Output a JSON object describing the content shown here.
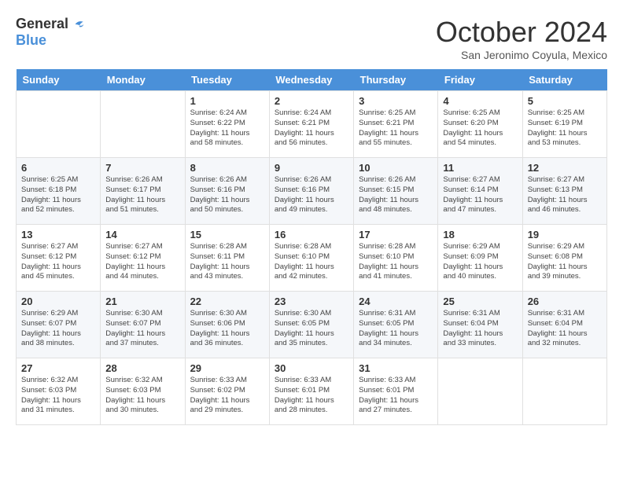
{
  "logo": {
    "general": "General",
    "blue": "Blue"
  },
  "header": {
    "title": "October 2024",
    "subtitle": "San Jeronimo Coyula, Mexico"
  },
  "weekdays": [
    "Sunday",
    "Monday",
    "Tuesday",
    "Wednesday",
    "Thursday",
    "Friday",
    "Saturday"
  ],
  "weeks": [
    [
      {
        "day": "",
        "info": ""
      },
      {
        "day": "",
        "info": ""
      },
      {
        "day": "1",
        "info": "Sunrise: 6:24 AM\nSunset: 6:22 PM\nDaylight: 11 hours and 58 minutes."
      },
      {
        "day": "2",
        "info": "Sunrise: 6:24 AM\nSunset: 6:21 PM\nDaylight: 11 hours and 56 minutes."
      },
      {
        "day": "3",
        "info": "Sunrise: 6:25 AM\nSunset: 6:21 PM\nDaylight: 11 hours and 55 minutes."
      },
      {
        "day": "4",
        "info": "Sunrise: 6:25 AM\nSunset: 6:20 PM\nDaylight: 11 hours and 54 minutes."
      },
      {
        "day": "5",
        "info": "Sunrise: 6:25 AM\nSunset: 6:19 PM\nDaylight: 11 hours and 53 minutes."
      }
    ],
    [
      {
        "day": "6",
        "info": "Sunrise: 6:25 AM\nSunset: 6:18 PM\nDaylight: 11 hours and 52 minutes."
      },
      {
        "day": "7",
        "info": "Sunrise: 6:26 AM\nSunset: 6:17 PM\nDaylight: 11 hours and 51 minutes."
      },
      {
        "day": "8",
        "info": "Sunrise: 6:26 AM\nSunset: 6:16 PM\nDaylight: 11 hours and 50 minutes."
      },
      {
        "day": "9",
        "info": "Sunrise: 6:26 AM\nSunset: 6:16 PM\nDaylight: 11 hours and 49 minutes."
      },
      {
        "day": "10",
        "info": "Sunrise: 6:26 AM\nSunset: 6:15 PM\nDaylight: 11 hours and 48 minutes."
      },
      {
        "day": "11",
        "info": "Sunrise: 6:27 AM\nSunset: 6:14 PM\nDaylight: 11 hours and 47 minutes."
      },
      {
        "day": "12",
        "info": "Sunrise: 6:27 AM\nSunset: 6:13 PM\nDaylight: 11 hours and 46 minutes."
      }
    ],
    [
      {
        "day": "13",
        "info": "Sunrise: 6:27 AM\nSunset: 6:12 PM\nDaylight: 11 hours and 45 minutes."
      },
      {
        "day": "14",
        "info": "Sunrise: 6:27 AM\nSunset: 6:12 PM\nDaylight: 11 hours and 44 minutes."
      },
      {
        "day": "15",
        "info": "Sunrise: 6:28 AM\nSunset: 6:11 PM\nDaylight: 11 hours and 43 minutes."
      },
      {
        "day": "16",
        "info": "Sunrise: 6:28 AM\nSunset: 6:10 PM\nDaylight: 11 hours and 42 minutes."
      },
      {
        "day": "17",
        "info": "Sunrise: 6:28 AM\nSunset: 6:10 PM\nDaylight: 11 hours and 41 minutes."
      },
      {
        "day": "18",
        "info": "Sunrise: 6:29 AM\nSunset: 6:09 PM\nDaylight: 11 hours and 40 minutes."
      },
      {
        "day": "19",
        "info": "Sunrise: 6:29 AM\nSunset: 6:08 PM\nDaylight: 11 hours and 39 minutes."
      }
    ],
    [
      {
        "day": "20",
        "info": "Sunrise: 6:29 AM\nSunset: 6:07 PM\nDaylight: 11 hours and 38 minutes."
      },
      {
        "day": "21",
        "info": "Sunrise: 6:30 AM\nSunset: 6:07 PM\nDaylight: 11 hours and 37 minutes."
      },
      {
        "day": "22",
        "info": "Sunrise: 6:30 AM\nSunset: 6:06 PM\nDaylight: 11 hours and 36 minutes."
      },
      {
        "day": "23",
        "info": "Sunrise: 6:30 AM\nSunset: 6:05 PM\nDaylight: 11 hours and 35 minutes."
      },
      {
        "day": "24",
        "info": "Sunrise: 6:31 AM\nSunset: 6:05 PM\nDaylight: 11 hours and 34 minutes."
      },
      {
        "day": "25",
        "info": "Sunrise: 6:31 AM\nSunset: 6:04 PM\nDaylight: 11 hours and 33 minutes."
      },
      {
        "day": "26",
        "info": "Sunrise: 6:31 AM\nSunset: 6:04 PM\nDaylight: 11 hours and 32 minutes."
      }
    ],
    [
      {
        "day": "27",
        "info": "Sunrise: 6:32 AM\nSunset: 6:03 PM\nDaylight: 11 hours and 31 minutes."
      },
      {
        "day": "28",
        "info": "Sunrise: 6:32 AM\nSunset: 6:03 PM\nDaylight: 11 hours and 30 minutes."
      },
      {
        "day": "29",
        "info": "Sunrise: 6:33 AM\nSunset: 6:02 PM\nDaylight: 11 hours and 29 minutes."
      },
      {
        "day": "30",
        "info": "Sunrise: 6:33 AM\nSunset: 6:01 PM\nDaylight: 11 hours and 28 minutes."
      },
      {
        "day": "31",
        "info": "Sunrise: 6:33 AM\nSunset: 6:01 PM\nDaylight: 11 hours and 27 minutes."
      },
      {
        "day": "",
        "info": ""
      },
      {
        "day": "",
        "info": ""
      }
    ]
  ]
}
